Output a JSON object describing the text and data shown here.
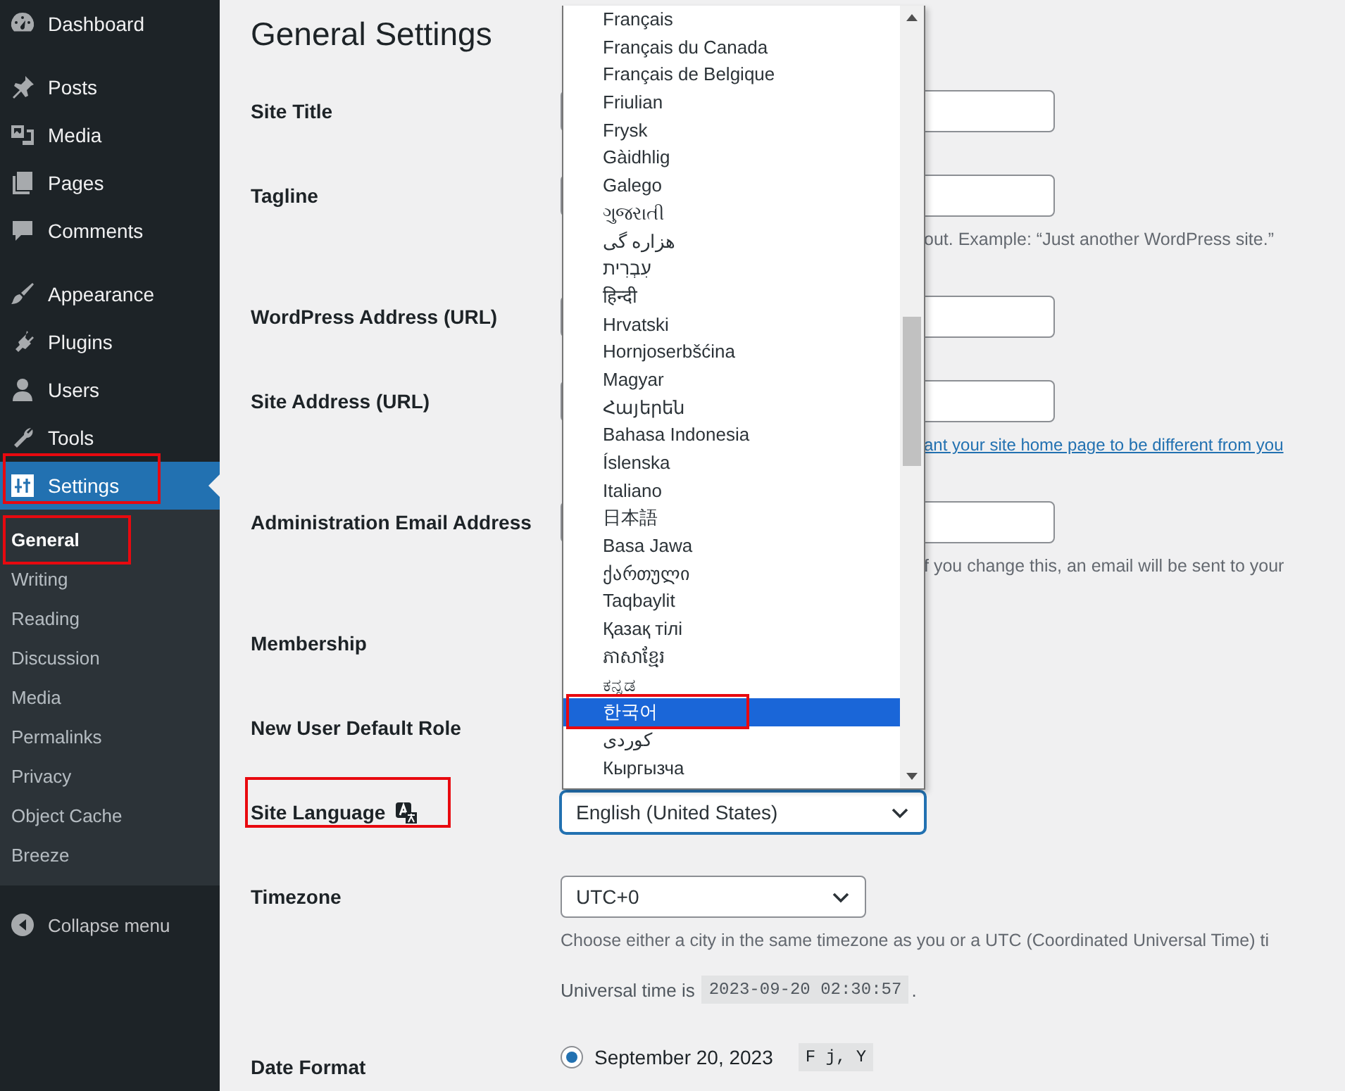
{
  "sidebar": {
    "groups": [
      {
        "items": [
          {
            "label": "Dashboard",
            "selected": false
          }
        ]
      },
      {
        "items": [
          {
            "label": "Posts",
            "selected": false
          },
          {
            "label": "Media",
            "selected": false
          },
          {
            "label": "Pages",
            "selected": false
          },
          {
            "label": "Comments",
            "selected": false
          }
        ]
      },
      {
        "items": [
          {
            "label": "Appearance",
            "selected": false
          },
          {
            "label": "Plugins",
            "selected": false
          },
          {
            "label": "Users",
            "selected": false
          },
          {
            "label": "Tools",
            "selected": false
          },
          {
            "label": "Settings",
            "selected": true,
            "highlighted": true,
            "children": [
              {
                "label": "General",
                "selected": true,
                "highlighted": true
              },
              {
                "label": "Writing",
                "selected": false
              },
              {
                "label": "Reading",
                "selected": false
              },
              {
                "label": "Discussion",
                "selected": false
              },
              {
                "label": "Media",
                "selected": false
              },
              {
                "label": "Permalinks",
                "selected": false
              },
              {
                "label": "Privacy",
                "selected": false
              },
              {
                "label": "Object Cache",
                "selected": false
              },
              {
                "label": "Breeze",
                "selected": false
              }
            ]
          }
        ]
      }
    ],
    "collapse_label": "Collapse menu"
  },
  "page": {
    "title": "General Settings",
    "rows": [
      {
        "label": "Site Title",
        "kind": "input"
      },
      {
        "label": "Tagline",
        "kind": "input",
        "help": "out. Example: “Just another WordPress site.”"
      },
      {
        "label": "WordPress Address (URL)",
        "kind": "input"
      },
      {
        "label": "Site Address (URL)",
        "kind": "input",
        "link": "ant your site home page to be different from you"
      },
      {
        "label": "Administration Email Address",
        "kind": "input",
        "help": "f you change this, an email will be sent to your"
      },
      {
        "label": "Membership",
        "kind": "covered"
      },
      {
        "label": "New User Default Role",
        "kind": "covered"
      },
      {
        "label": "Site Language",
        "kind": "language",
        "value": "English (United States)",
        "highlighted": true,
        "dropdown": {
          "options": [
            {
              "label": "Français",
              "selected": false
            },
            {
              "label": "Français du Canada",
              "selected": false
            },
            {
              "label": "Français de Belgique",
              "selected": false
            },
            {
              "label": "Friulian",
              "selected": false
            },
            {
              "label": "Frysk",
              "selected": false
            },
            {
              "label": "Gàidhlig",
              "selected": false
            },
            {
              "label": "Galego",
              "selected": false
            },
            {
              "label": "ગુજરાતી",
              "selected": false
            },
            {
              "label": "هزاره گی",
              "selected": false
            },
            {
              "label": "עִבְרִית",
              "selected": false
            },
            {
              "label": "हिन्दी",
              "selected": false
            },
            {
              "label": "Hrvatski",
              "selected": false
            },
            {
              "label": "Hornjoserbšćina",
              "selected": false
            },
            {
              "label": "Magyar",
              "selected": false
            },
            {
              "label": "Հայերեն",
              "selected": false
            },
            {
              "label": "Bahasa Indonesia",
              "selected": false
            },
            {
              "label": "Íslenska",
              "selected": false
            },
            {
              "label": "Italiano",
              "selected": false
            },
            {
              "label": "日本語",
              "selected": false
            },
            {
              "label": "Basa Jawa",
              "selected": false
            },
            {
              "label": "ქართული",
              "selected": false
            },
            {
              "label": "Taqbaylit",
              "selected": false
            },
            {
              "label": "Қазақ тілі",
              "selected": false
            },
            {
              "label": "ភាសាខ្មែរ",
              "selected": false
            },
            {
              "label": "ಕನ್ನಡ",
              "selected": false
            },
            {
              "label": "한국어",
              "selected": true,
              "highlighted": true
            },
            {
              "label": "كوردی",
              "selected": false
            },
            {
              "label": "Кыргызча",
              "selected": false
            }
          ]
        }
      },
      {
        "label": "Timezone",
        "kind": "select",
        "value": "UTC+0",
        "help": "Choose either a city in the same timezone as you or a UTC (Coordinated Universal Time) ti",
        "time": {
          "prefix": "Universal time is",
          "code": "2023-09-20 02:30:57",
          "suffix": "."
        }
      },
      {
        "label": "Date Format",
        "kind": "radios",
        "options": [
          {
            "label": "September 20, 2023",
            "code": "F j, Y",
            "selected": true
          }
        ]
      }
    ]
  }
}
